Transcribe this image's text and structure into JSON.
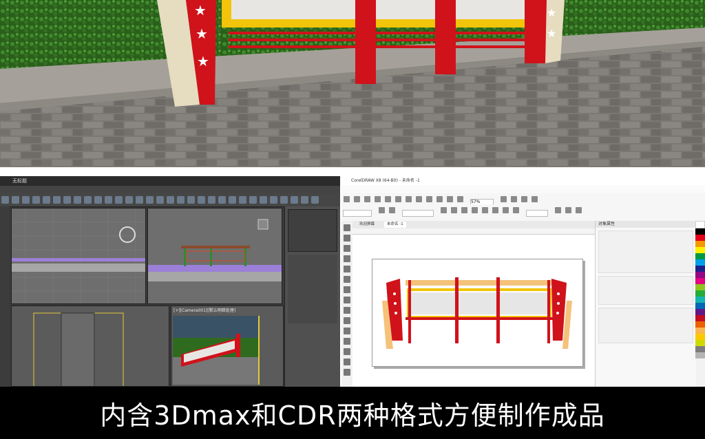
{
  "caption": "内含3Dmax和CDR两种格式方便制作成品",
  "max_window": {
    "title": "无标题",
    "viewport_perspective_label": "[+][Camera001][默认明暗处理]"
  },
  "cdr_window": {
    "title": "CorelDRAW X8 (64-Bit) - 未命名 -1",
    "tabs": [
      "欢迎屏幕",
      "未命名 -1"
    ],
    "zoom": "57%",
    "docker_title": "对象属性"
  },
  "colors": {
    "billboard_red": "#d0121b",
    "billboard_yellow": "#f2c40a",
    "billboard_cream": "#e6dcc0",
    "hedge": "#2f6b1e",
    "paving": "#7b7873"
  }
}
